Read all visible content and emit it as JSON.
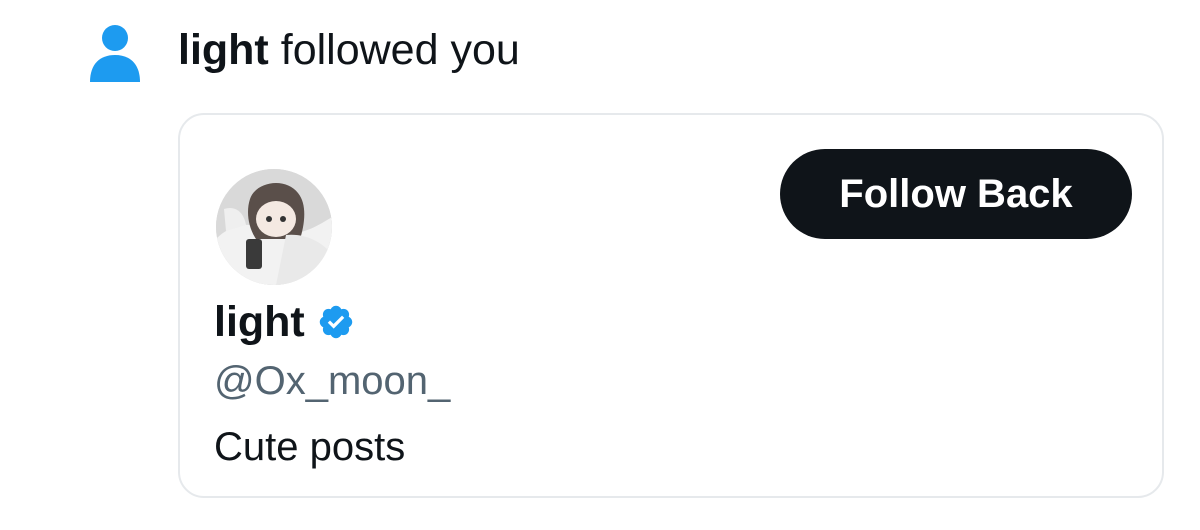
{
  "notification": {
    "icon": "person-icon",
    "actor_name": "light",
    "action_text": "followed you"
  },
  "profile_card": {
    "avatar": "avatar-image",
    "display_name": "light",
    "verified_icon": "verified-badge-icon",
    "handle": "@Ox_moon_",
    "bio": "Cute posts",
    "follow_button_label": "Follow Back"
  },
  "colors": {
    "accent_blue": "#1d9bf0",
    "button_bg": "#0f1419",
    "button_text": "#ffffff",
    "secondary_text": "#536471",
    "card_border": "#e6e9ec"
  }
}
